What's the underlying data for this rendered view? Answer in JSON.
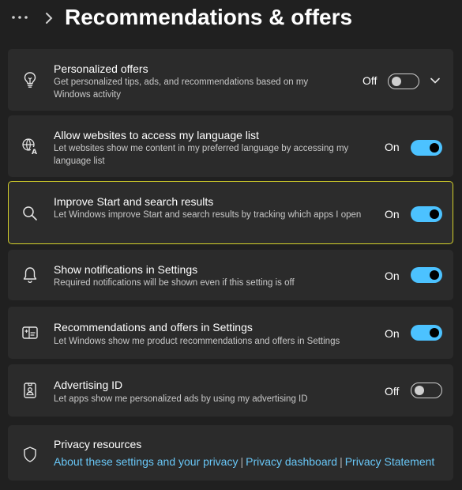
{
  "header": {
    "more_icon": "more-dots-icon",
    "chevron_icon": "chevron-right-icon",
    "title": "Recommendations & offers"
  },
  "settings": [
    {
      "icon": "lightbulb-icon",
      "title": "Personalized offers",
      "description": "Get personalized tips, ads, and recommendations based on my Windows activity",
      "state": "Off",
      "toggle_on": false,
      "expandable": true
    },
    {
      "icon": "language-icon",
      "title": "Allow websites to access my language list",
      "description": "Let websites show me content in my preferred language by accessing my language list",
      "state": "On",
      "toggle_on": true
    },
    {
      "icon": "search-icon",
      "title": "Improve Start and search results",
      "description": "Let Windows improve Start and search results by tracking which apps I open",
      "state": "On",
      "toggle_on": true,
      "highlighted": true
    },
    {
      "icon": "bell-icon",
      "title": "Show notifications in Settings",
      "description": "Required notifications will be shown even if this setting is off",
      "state": "On",
      "toggle_on": true
    },
    {
      "icon": "settings-offers-icon",
      "title": "Recommendations and offers in Settings",
      "description": "Let Windows show me product recommendations and offers in Settings",
      "state": "On",
      "toggle_on": true
    },
    {
      "icon": "advertising-id-icon",
      "title": "Advertising ID",
      "description": "Let apps show me personalized ads by using my advertising ID",
      "state": "Off",
      "toggle_on": false
    }
  ],
  "privacy": {
    "icon": "shield-icon",
    "title": "Privacy resources",
    "links": [
      "About these settings and your privacy",
      "Privacy dashboard",
      "Privacy Statement"
    ],
    "separator": "|"
  },
  "colors": {
    "accent": "#4cc2ff",
    "link": "#69c7f7",
    "highlight_border": "#d6d22a",
    "card_bg": "#2b2b2b",
    "page_bg": "#202020"
  }
}
